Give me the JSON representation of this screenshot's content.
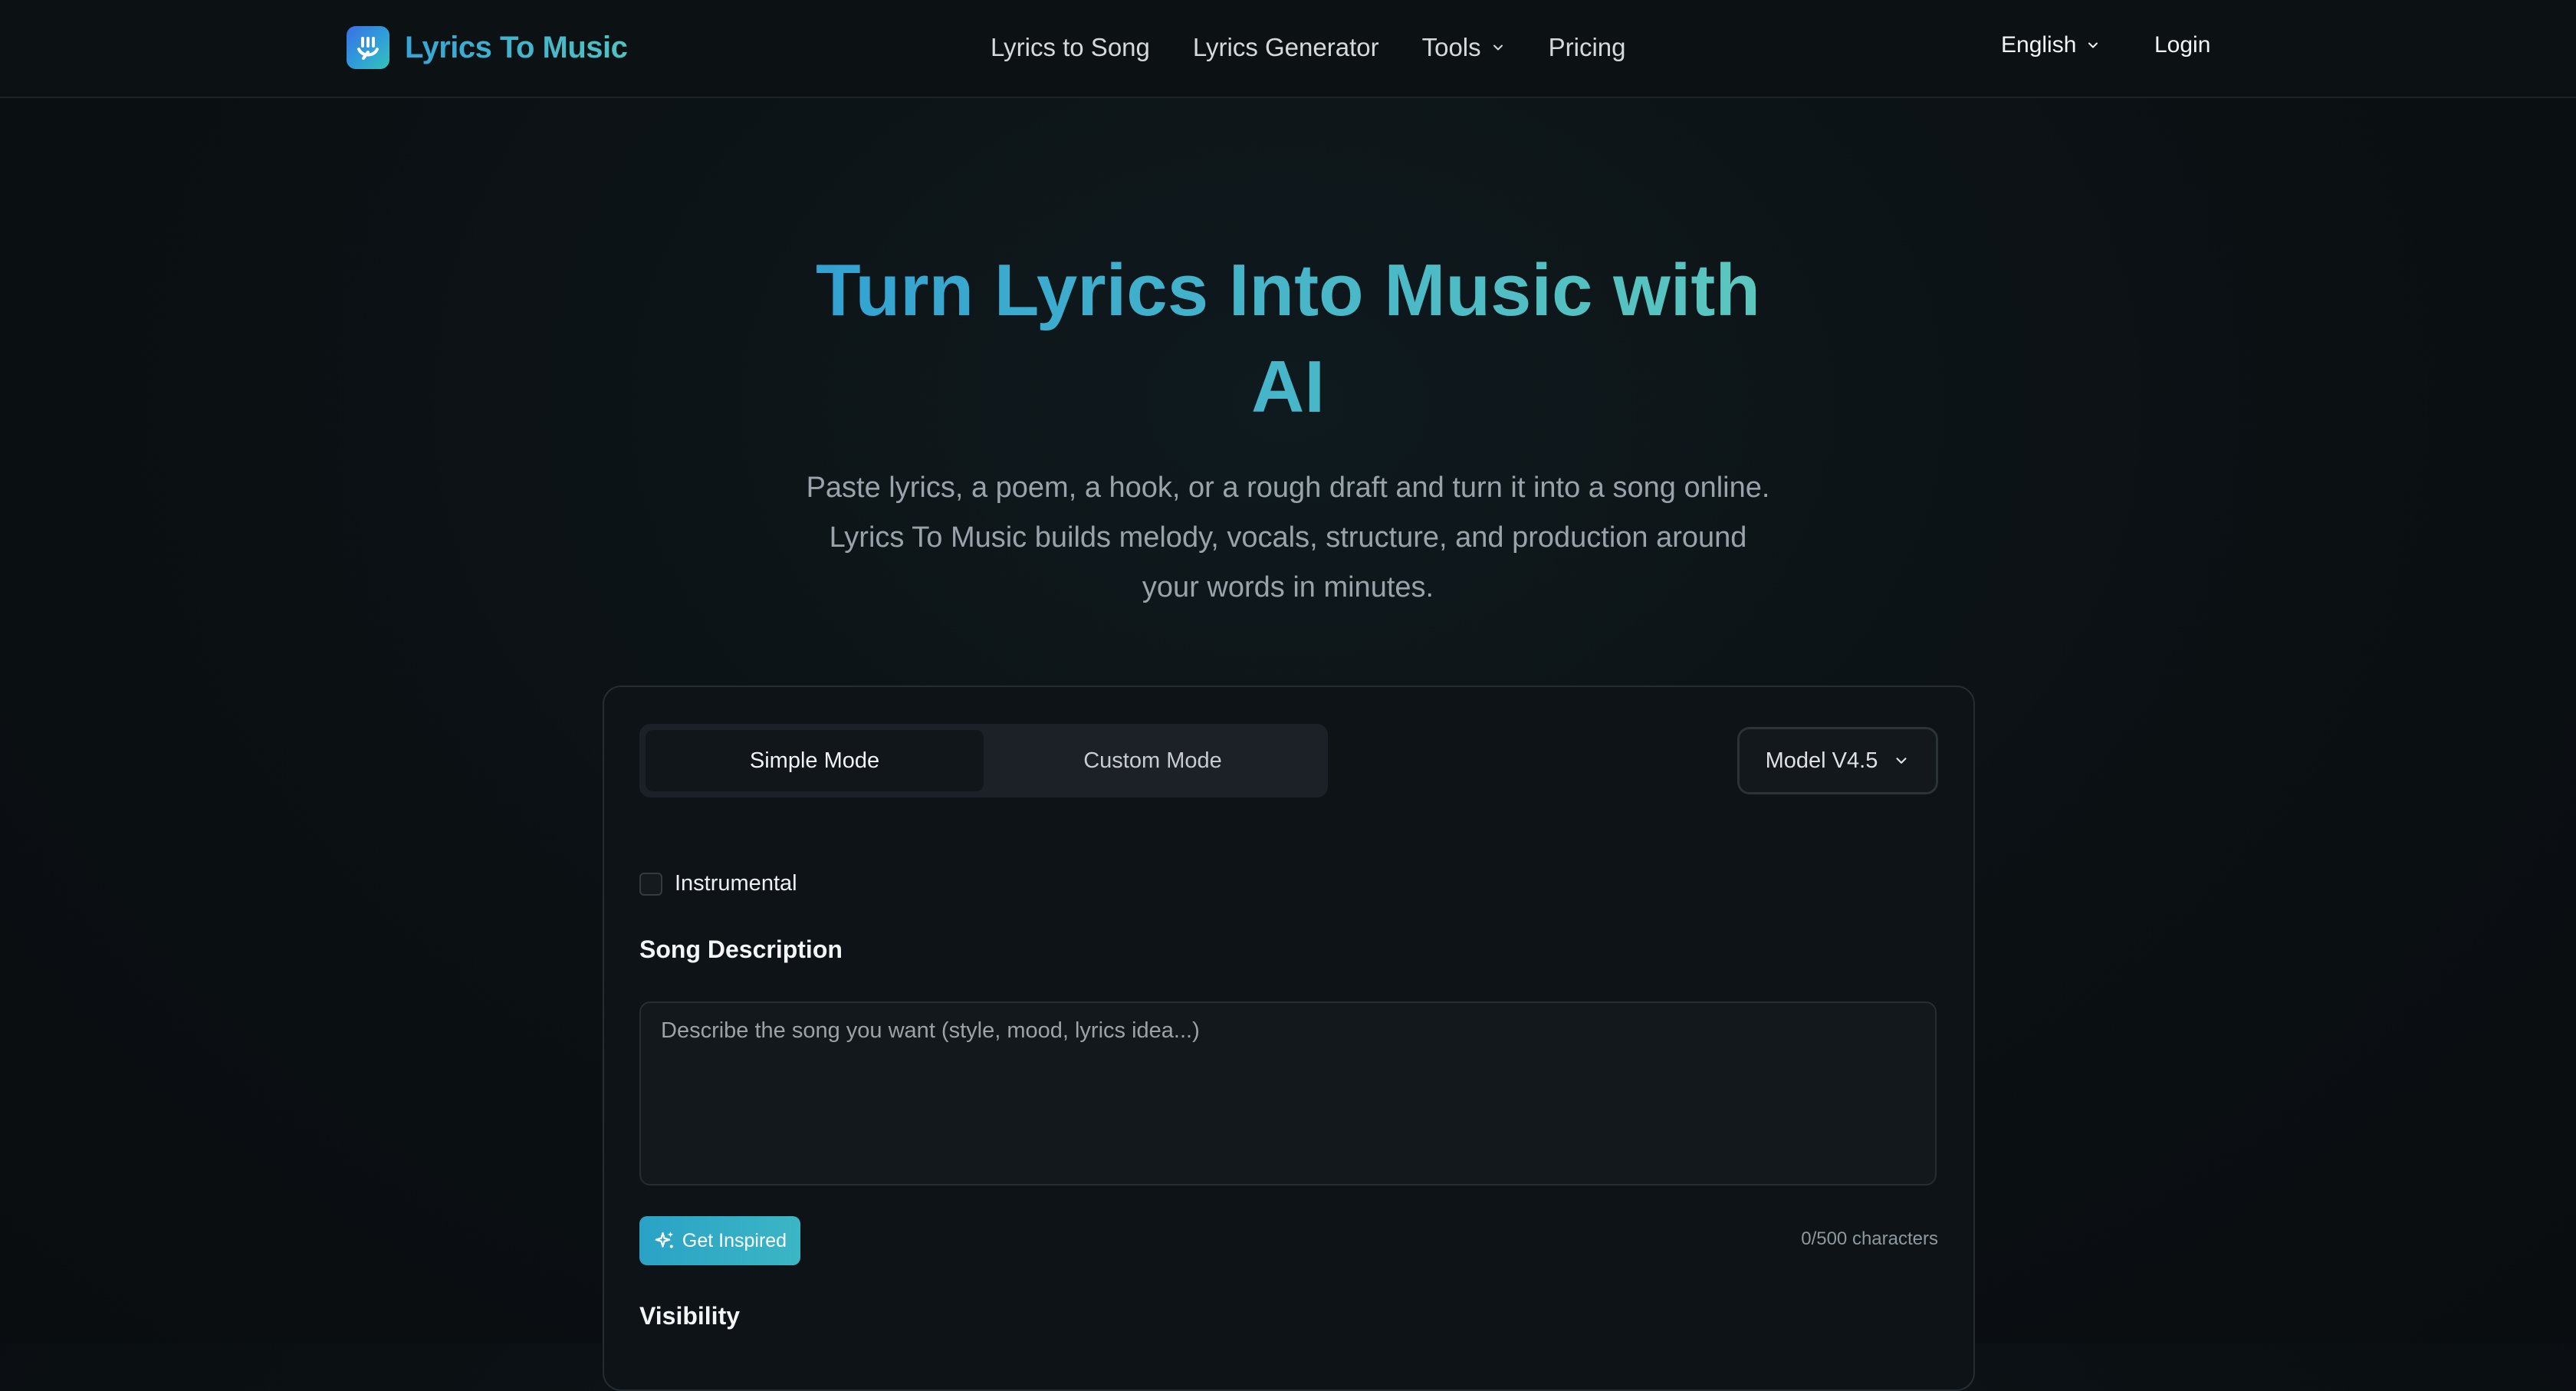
{
  "header": {
    "brand": "Lyrics To Music",
    "nav": [
      {
        "label": "Lyrics to Song"
      },
      {
        "label": "Lyrics Generator"
      },
      {
        "label": "Tools",
        "has_dropdown": true
      },
      {
        "label": "Pricing"
      }
    ],
    "language": "English",
    "login": "Login"
  },
  "hero": {
    "title_line1": "Turn Lyrics Into Music with",
    "title_line2": "AI",
    "subtitle_line1": "Paste lyrics, a poem, a hook, or a rough draft and turn it into a song online.",
    "subtitle_line2": "Lyrics To Music builds melody, vocals, structure, and production around",
    "subtitle_line3": "your words in minutes."
  },
  "generator": {
    "modes": [
      {
        "label": "Simple Mode",
        "active": true
      },
      {
        "label": "Custom Mode",
        "active": false
      }
    ],
    "model": "Model V4.5",
    "instrumental_label": "Instrumental",
    "instrumental_checked": false,
    "description_label": "Song Description",
    "description_placeholder": "Describe the song you want (style, mood, lyrics idea...)",
    "description_value": "",
    "inspire_label": "Get Inspired",
    "char_count": "0/500 characters",
    "visibility_label": "Visibility"
  },
  "colors": {
    "accent_start": "#2f9fd4",
    "accent_end": "#5ec9bd",
    "background": "#0b1013",
    "card": "#0d1317"
  },
  "icons": {
    "logo": "music-note-logo-icon",
    "dropdown": "chevron-down-icon",
    "inspire": "sparkles-icon"
  }
}
